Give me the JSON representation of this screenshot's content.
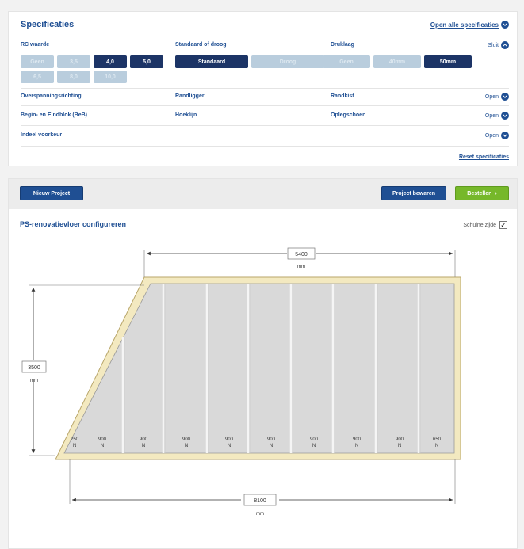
{
  "spec": {
    "title": "Specificaties",
    "open_all": "Open alle specificaties",
    "rc": {
      "label": "RC waarde",
      "options": [
        "Geen",
        "3,5",
        "4,0",
        "5,0",
        "6,5",
        "8,0",
        "10,0"
      ]
    },
    "standaard": {
      "label": "Standaard of droog",
      "options": [
        "Standaard",
        "Droog"
      ]
    },
    "druklaag": {
      "label": "Druklaag",
      "options": [
        "Geen",
        "40mm",
        "50mm"
      ]
    },
    "sluit": "Sluit",
    "rows": {
      "overspanning": "Overspanningsrichting",
      "randligger": "Randligger",
      "randkist": "Randkist",
      "begin_eind": "Begin- en Eindblok (BeB)",
      "hoeklijn": "Hoeklijn",
      "oplegschoen": "Oplegschoen",
      "indeel": "Indeel voorkeur"
    },
    "open": "Open",
    "reset": "Reset specificaties"
  },
  "toolbar": {
    "new_project": "Nieuw Project",
    "save_project": "Project bewaren",
    "order": "Bestellen"
  },
  "config": {
    "title": "PS-renovatievloer configureren",
    "schuine_zijde": "Schuine zijde",
    "schuine_checked": "✓"
  },
  "drawing": {
    "top_dim": "5400",
    "left_dim": "3500",
    "bottom_dim": "8100",
    "unit": "mm",
    "panel_values": [
      "250",
      "900",
      "900",
      "900",
      "900",
      "900",
      "900",
      "900",
      "900",
      "650"
    ],
    "panel_unit": "N"
  }
}
